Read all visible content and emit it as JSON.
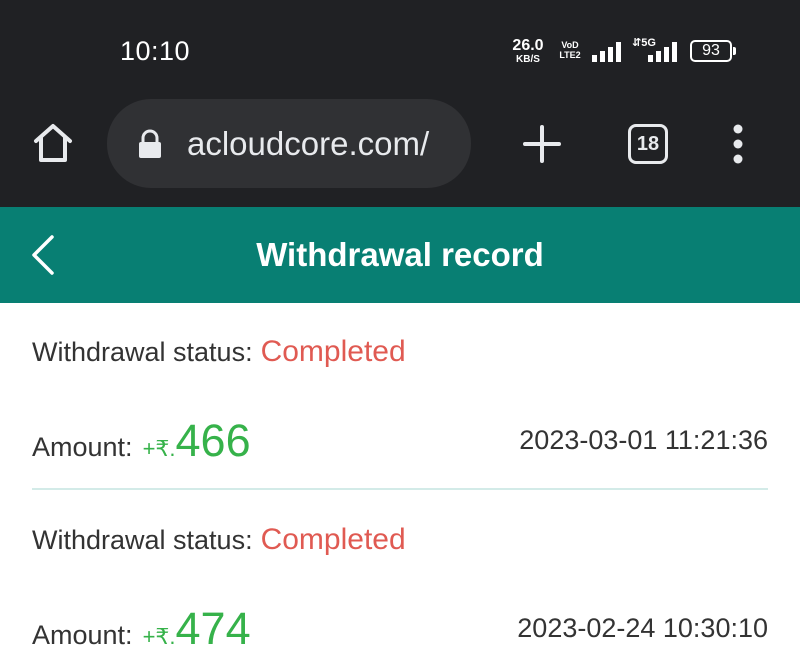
{
  "status_bar": {
    "time": "10:10",
    "net_speed_value": "26.0",
    "net_speed_unit": "KB/S",
    "volte_top": "VoD",
    "volte_bottom": "LTE2",
    "network_type": "5G",
    "battery": "93"
  },
  "browser": {
    "url": "acloudcore.com/",
    "tab_count": "18",
    "icons": {
      "home": "home-icon",
      "lock": "lock-icon",
      "new_tab": "plus-icon",
      "menu": "more-vertical-icon"
    }
  },
  "header": {
    "title": "Withdrawal record",
    "background_color": "#087f73"
  },
  "records": [
    {
      "status_label": "Withdrawal status:",
      "status": "Completed",
      "amount_label": "Amount:",
      "amount_prefix": "+₹.",
      "amount": "466",
      "time": "2023-03-01 11:21:36"
    },
    {
      "status_label": "Withdrawal status:",
      "status": "Completed",
      "amount_label": "Amount:",
      "amount_prefix": "+₹.",
      "amount": "474",
      "time": "2023-02-24 10:30:10"
    }
  ],
  "colors": {
    "status_completed": "#e05a52",
    "amount": "#36b24a",
    "divider": "#d3ebe8"
  }
}
